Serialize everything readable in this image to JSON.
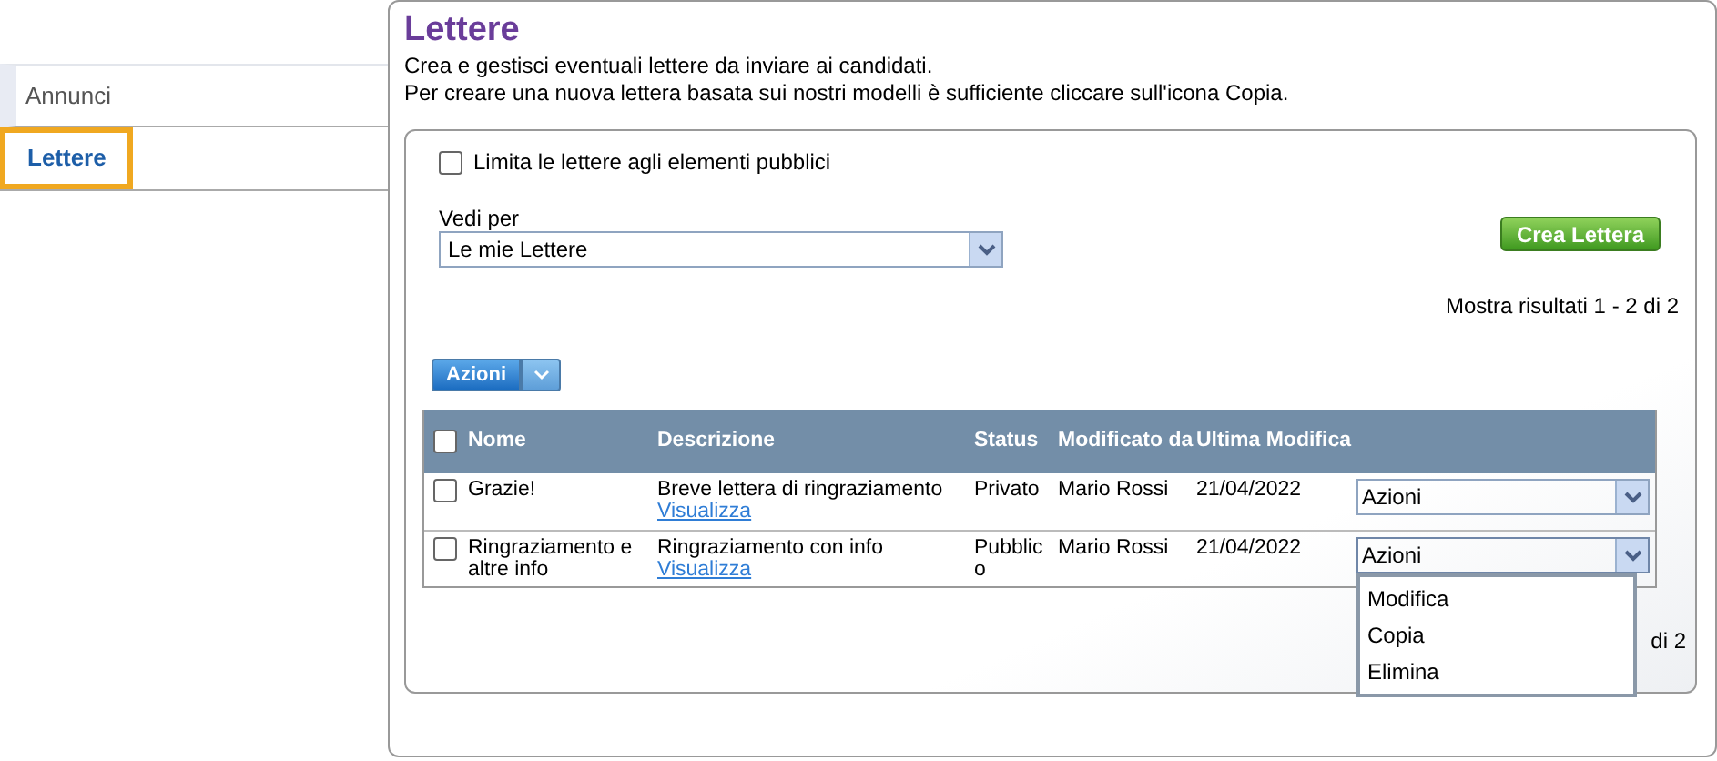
{
  "sidebar": {
    "items": [
      {
        "label": "Annunci",
        "selected": false
      },
      {
        "label": "Lettere",
        "selected": true
      }
    ]
  },
  "page": {
    "title": "Lettere",
    "description": [
      "Crea e gestisci eventuali lettere da inviare ai candidati.",
      "Per creare una nuova lettera basata sui nostri modelli è sufficiente cliccare sull'icona Copia."
    ]
  },
  "filter": {
    "label": "Limita le lettere agli elementi pubblici",
    "checked": false
  },
  "view_by": {
    "label": "Vedi per",
    "value": "Le mie Lettere"
  },
  "create_button": "Crea Lettera",
  "results_top": "Mostra risultati 1 - 2 di 2",
  "bulk_actions": "Azioni",
  "table": {
    "select_all_checked": false,
    "columns": [
      "Nome",
      "Descrizione",
      "Status",
      "Modificato da",
      "Ultima Modifica"
    ],
    "rows": [
      {
        "checked": false,
        "name": "Grazie!",
        "description": "Breve lettera di ringraziamento",
        "link": "Visualizza",
        "status": "Privato",
        "modified_by": "Mario Rossi",
        "date": "21/04/2022",
        "action": "Azioni",
        "expanded": false
      },
      {
        "checked": false,
        "name": "Ringraziamento e altre info",
        "description": "Ringraziamento con info",
        "link": "Visualizza",
        "status": "Pubblic o",
        "modified_by": "Mario Rossi",
        "date": "21/04/2022",
        "action": "Azioni",
        "expanded": true,
        "options": [
          "Modifica",
          "Copia",
          "Elimina"
        ]
      }
    ]
  },
  "results_bottom": "di 2"
}
